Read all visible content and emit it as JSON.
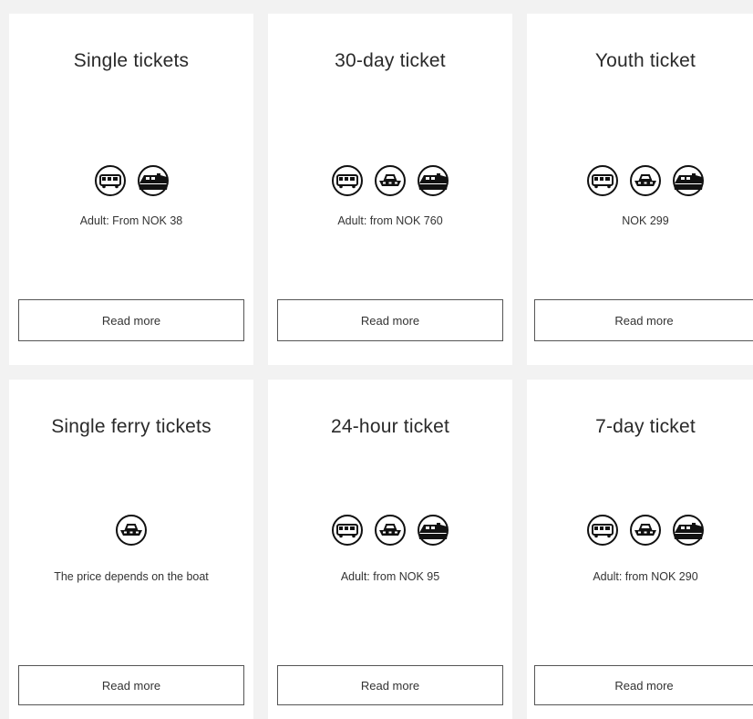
{
  "cards": [
    {
      "title": "Single tickets",
      "icons": [
        "bus-icon",
        "train-icon"
      ],
      "price": "Adult: From NOK 38",
      "button": "Read more"
    },
    {
      "title": "30-day ticket",
      "icons": [
        "bus-icon",
        "boat-icon",
        "train-icon"
      ],
      "price": "Adult: from NOK 760",
      "button": "Read more"
    },
    {
      "title": "Youth ticket",
      "icons": [
        "bus-icon",
        "boat-icon",
        "train-icon"
      ],
      "price": "NOK 299",
      "button": "Read more"
    },
    {
      "title": "Single ferry tickets",
      "icons": [
        "boat-icon"
      ],
      "price": "The price depends on the boat",
      "button": "Read more"
    },
    {
      "title": "24-hour ticket",
      "icons": [
        "bus-icon",
        "boat-icon",
        "train-icon"
      ],
      "price": "Adult: from NOK 95",
      "button": "Read more"
    },
    {
      "title": "7-day ticket",
      "icons": [
        "bus-icon",
        "boat-icon",
        "train-icon"
      ],
      "price": "Adult: from NOK 290",
      "button": "Read more"
    }
  ]
}
